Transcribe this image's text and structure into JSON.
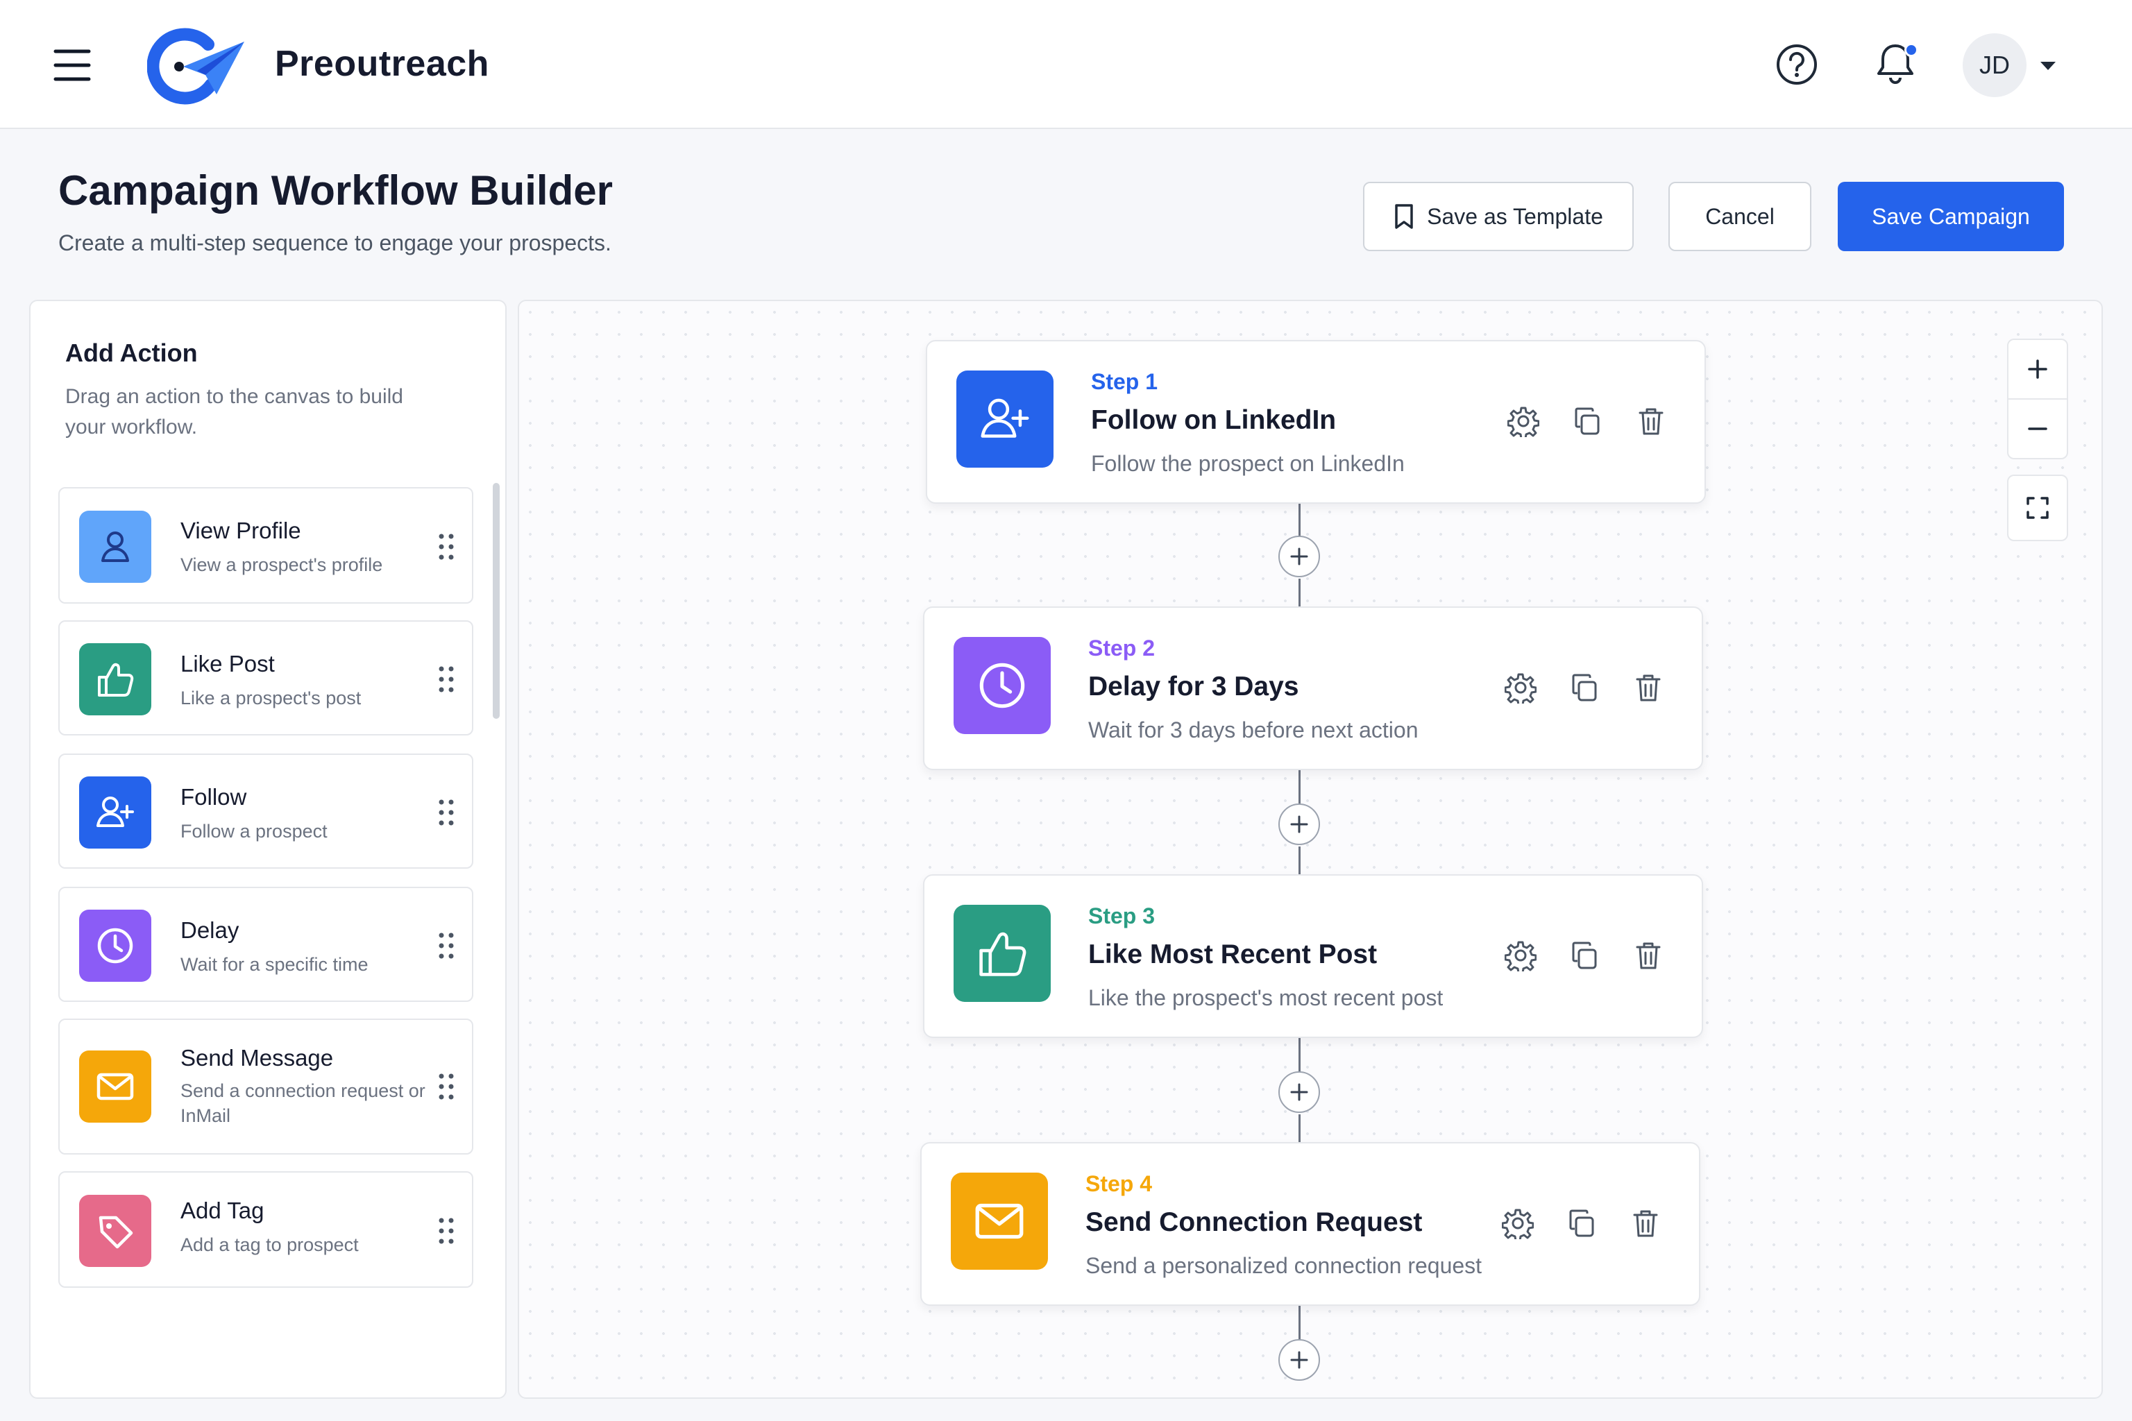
{
  "app": {
    "brand": "Preoutreach",
    "user_initials": "JD"
  },
  "page": {
    "title": "Campaign Workflow Builder",
    "subtitle": "Create a multi-step sequence to engage your prospects."
  },
  "buttons": {
    "save_template": "Save as Template",
    "cancel": "Cancel",
    "save_campaign": "Save Campaign"
  },
  "sidebar": {
    "title": "Add Action",
    "description": "Drag an action to the canvas to build your workflow.",
    "actions": [
      {
        "title": "View Profile",
        "desc": "View a prospect's profile",
        "icon": "user-icon",
        "color": "#60a5fa"
      },
      {
        "title": "Like Post",
        "desc": "Like a prospect's post",
        "icon": "thumbs-up-icon",
        "color": "#2a9d83"
      },
      {
        "title": "Follow",
        "desc": "Follow a prospect",
        "icon": "user-plus-icon",
        "color": "#2563eb"
      },
      {
        "title": "Delay",
        "desc": "Wait for a specific time",
        "icon": "clock-icon",
        "color": "#8b5cf6"
      },
      {
        "title": "Send Message",
        "desc": "Send a connection request or InMail",
        "icon": "mail-icon",
        "color": "#f5a70a"
      },
      {
        "title": "Add Tag",
        "desc": "Add a tag to prospect",
        "icon": "tag-icon",
        "color": "#e66a8a"
      }
    ]
  },
  "steps": [
    {
      "label": "Step 1",
      "title": "Follow on LinkedIn",
      "desc": "Follow the prospect on LinkedIn",
      "icon": "user-plus-icon",
      "color": "#2563eb"
    },
    {
      "label": "Step 2",
      "title": "Delay for 3 Days",
      "desc": "Wait for 3 days before next action",
      "icon": "clock-icon",
      "color": "#8b5cf6"
    },
    {
      "label": "Step 3",
      "title": "Like Most Recent Post",
      "desc": "Like the prospect's most recent post",
      "icon": "thumbs-up-icon",
      "color": "#2a9d83"
    },
    {
      "label": "Step 4",
      "title": "Send Connection Request",
      "desc": "Send a personalized connection request",
      "icon": "mail-icon",
      "color": "#f5a70a"
    }
  ],
  "colors": {
    "primary": "#2563eb",
    "notification_dot": "#2563eb"
  }
}
